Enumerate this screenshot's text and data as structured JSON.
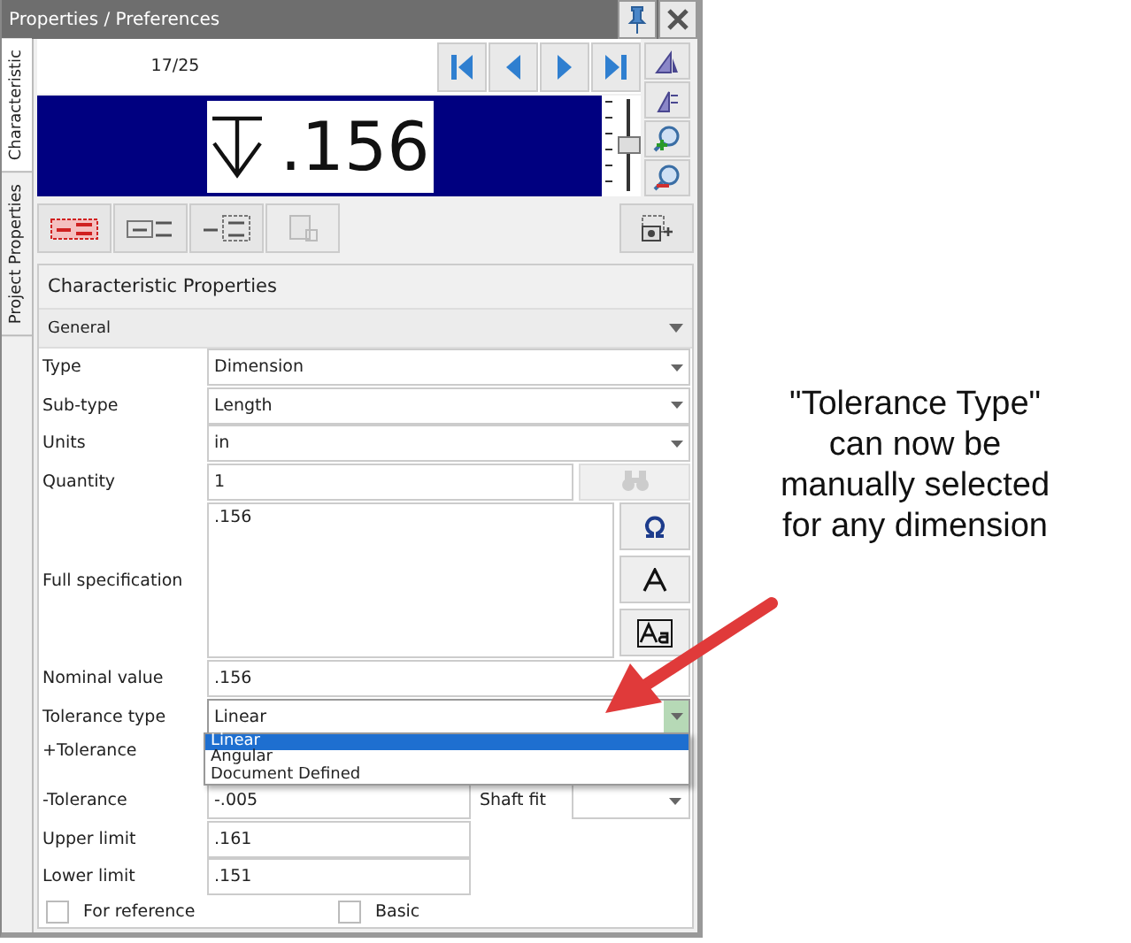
{
  "window": {
    "title": "Properties / Preferences"
  },
  "side_tabs": [
    {
      "label": "Characteristic",
      "selected": true
    },
    {
      "label": "Project Properties",
      "selected": false
    }
  ],
  "navigator": {
    "counter": "17/25"
  },
  "preview": {
    "value": ".156",
    "slider": {
      "level": 0.5
    }
  },
  "section": {
    "title": "Characteristic Properties",
    "group": "General"
  },
  "fields": [
    {
      "kind": "select",
      "label": "Type",
      "value": "Dimension"
    },
    {
      "kind": "select",
      "label": "Sub-type",
      "value": "Length"
    },
    {
      "kind": "select",
      "label": "Units",
      "value": "in"
    },
    {
      "kind": "input_button",
      "label": "Quantity",
      "value": "1"
    },
    {
      "kind": "textarea",
      "label": "Full specification",
      "value": ".156"
    },
    {
      "kind": "input",
      "label": "Nominal value",
      "value": ".156"
    },
    {
      "kind": "dropdown",
      "label": "Tolerance type",
      "value": "Linear",
      "open": true,
      "options": [
        {
          "label": "Linear",
          "selected": true
        },
        {
          "label": "Angular",
          "selected": false
        },
        {
          "label": "Document Defined",
          "selected": false
        }
      ]
    },
    {
      "kind": "label",
      "label": "+Tolerance"
    },
    {
      "kind": "input_fit",
      "label": "-Tolerance",
      "value": "-.005",
      "fit_label": "Shaft fit"
    },
    {
      "kind": "short_input",
      "label": "Upper limit",
      "value": ".161"
    },
    {
      "kind": "short_input",
      "label": "Lower limit",
      "value": ".151"
    }
  ],
  "checkboxes": [
    {
      "label": "For reference",
      "checked": false
    },
    {
      "label": "Basic",
      "checked": false
    }
  ],
  "annotation": {
    "lines": [
      "\"Tolerance Type\"",
      "can now be",
      "manually selected",
      "for any dimension"
    ]
  }
}
